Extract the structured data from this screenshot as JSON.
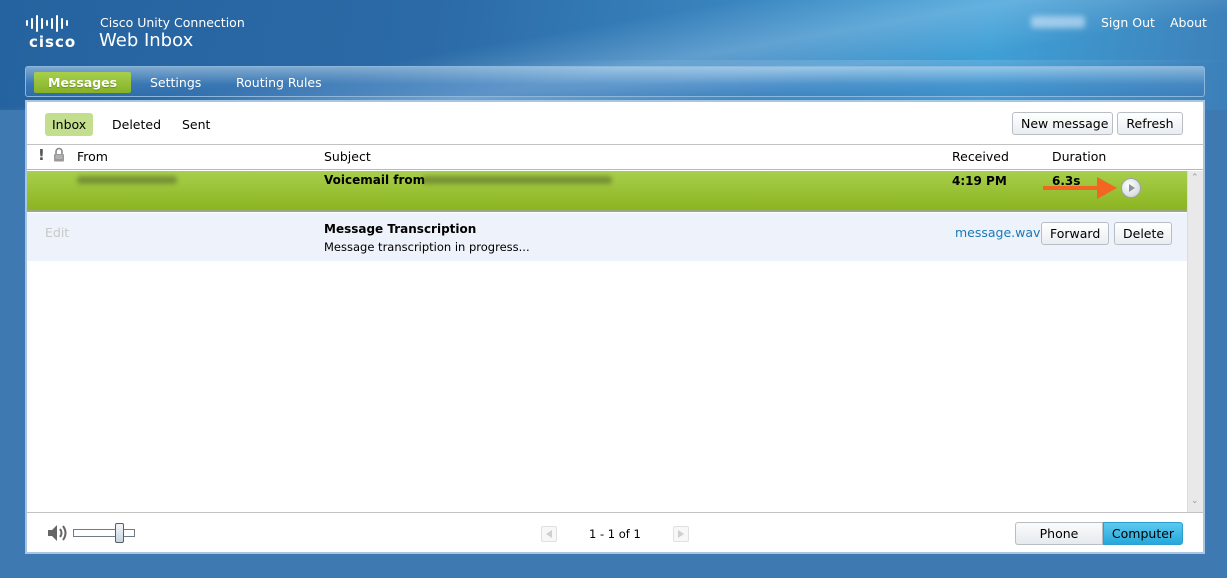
{
  "header": {
    "brand": "cisco",
    "app_subtitle": "Cisco Unity Connection",
    "app_title": "Web Inbox",
    "user_name_redacted": true,
    "links": [
      {
        "label": "Sign Out"
      },
      {
        "label": "About"
      }
    ]
  },
  "nav": {
    "tabs": [
      {
        "label": "Messages",
        "active": true
      },
      {
        "label": "Settings",
        "active": false
      },
      {
        "label": "Routing Rules",
        "active": false
      }
    ]
  },
  "folders": {
    "tabs": [
      {
        "label": "Inbox",
        "active": true
      },
      {
        "label": "Deleted",
        "active": false
      },
      {
        "label": "Sent",
        "active": false
      }
    ]
  },
  "toolbar": {
    "new_message_label": "New message",
    "refresh_label": "Refresh"
  },
  "table": {
    "columns": {
      "priority_icon": "exclamation-icon",
      "secure_icon": "lock-icon",
      "from": "From",
      "subject": "Subject",
      "received": "Received",
      "duration": "Duration"
    },
    "rows": [
      {
        "from": "[redacted]",
        "subject_prefix": "Voicemail from",
        "subject_redacted": true,
        "received": "4:19 PM",
        "duration": "6.3s",
        "selected": true,
        "play_icon": "play-icon",
        "annotation": "orange-arrow-pointing-to-play"
      }
    ],
    "detail": {
      "edit_label": "Edit",
      "transcription_title": "Message Transcription",
      "transcription_text": "Message transcription in progress...",
      "attachment_label": "message.wav",
      "forward_label": "Forward",
      "delete_label": "Delete"
    }
  },
  "footer": {
    "volume_icon": "speaker-icon",
    "volume_level_percent": 80,
    "pager_text": "1 - 1 of 1",
    "playback_options": [
      {
        "label": "Phone",
        "active": false
      },
      {
        "label": "Computer",
        "active": true
      }
    ]
  },
  "colors": {
    "page_bg": "#3f79b2",
    "accent_green": "#9ac53a",
    "active_tab_green": "#c3df8e",
    "link_blue": "#1a7ab8",
    "segment_active": "#38b6e6",
    "annotation_orange": "#f26522"
  }
}
